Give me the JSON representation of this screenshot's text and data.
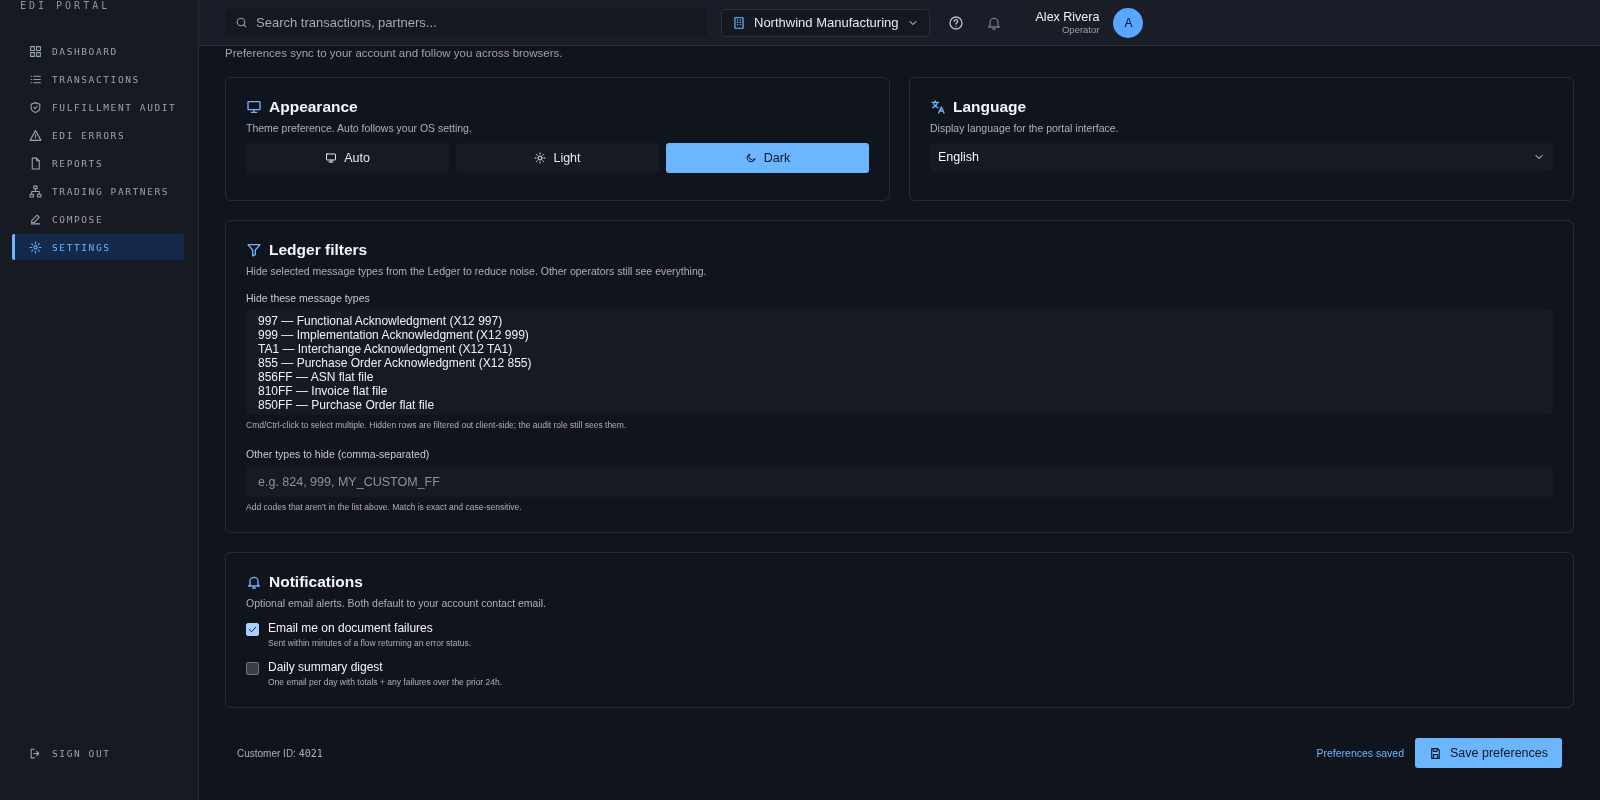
{
  "sidebar": {
    "brand": "EDI PORTAL",
    "items": [
      {
        "label": "DASHBOARD",
        "selected": false
      },
      {
        "label": "TRANSACTIONS",
        "selected": false
      },
      {
        "label": "FULFILLMENT AUDIT",
        "selected": false
      },
      {
        "label": "EDI ERRORS",
        "selected": false
      },
      {
        "label": "REPORTS",
        "selected": false
      },
      {
        "label": "TRADING PARTNERS",
        "selected": false
      },
      {
        "label": "COMPOSE",
        "selected": false
      },
      {
        "label": "SETTINGS",
        "selected": true
      }
    ],
    "sign_out": "SIGN OUT"
  },
  "header": {
    "search": {
      "placeholder": "Search transactions, partners..."
    },
    "organization": "Northwind Manufacturing",
    "user": {
      "name": "Alex Rivera",
      "role": "Operator",
      "initial": "A"
    }
  },
  "subtitle": "Preferences sync to your account and follow you across browsers.",
  "appearance": {
    "title": "Appearance",
    "description": "Theme preference. Auto follows your OS setting.",
    "options": [
      {
        "label": "Auto",
        "selected": false
      },
      {
        "label": "Light",
        "selected": false
      },
      {
        "label": "Dark",
        "selected": true
      }
    ]
  },
  "language": {
    "title": "Language",
    "description": "Display language for the portal interface.",
    "value": "English"
  },
  "ledger_filters": {
    "title": "Ledger filters",
    "description": "Hide selected message types from the Ledger to reduce noise. Other operators still see everything.",
    "list_label": "Hide these message types",
    "message_types": [
      {
        "label": "997 — Functional Acknowledgment (X12 997)",
        "selected": false
      },
      {
        "label": "999 — Implementation Acknowledgment (X12 999)",
        "selected": false
      },
      {
        "label": "TA1 — Interchange Acknowledgment (X12 TA1)",
        "selected": false
      },
      {
        "label": "855 — Purchase Order Acknowledgment (X12 855)",
        "selected": false
      },
      {
        "label": "856FF — ASN flat file",
        "selected": false
      },
      {
        "label": "810FF — Invoice flat file",
        "selected": false
      },
      {
        "label": "850FF — Purchase Order flat file",
        "selected": false
      }
    ],
    "list_hint": "Cmd/Ctrl-click to select multiple. Hidden rows are filtered out client-side; the audit role still sees them.",
    "other_label": "Other types to hide (comma-separated)",
    "other_placeholder": "e.g. 824, 999, MY_CUSTOM_FF",
    "other_hint": "Add codes that aren't in the list above. Match is exact and case-sensitive."
  },
  "notifications": {
    "title": "Notifications",
    "description": "Optional email alerts. Both default to your account contact email.",
    "options": [
      {
        "label": "Email me on document failures",
        "hint": "Sent within minutes of a flow returning an error status.",
        "checked": true
      },
      {
        "label": "Daily summary digest",
        "hint": "One email per day with totals + any failures over the prior 24h.",
        "checked": false
      }
    ]
  },
  "footer": {
    "customer_label": "Customer ID:",
    "customer_id": "4021",
    "status": "Preferences saved",
    "save": "Save preferences"
  }
}
